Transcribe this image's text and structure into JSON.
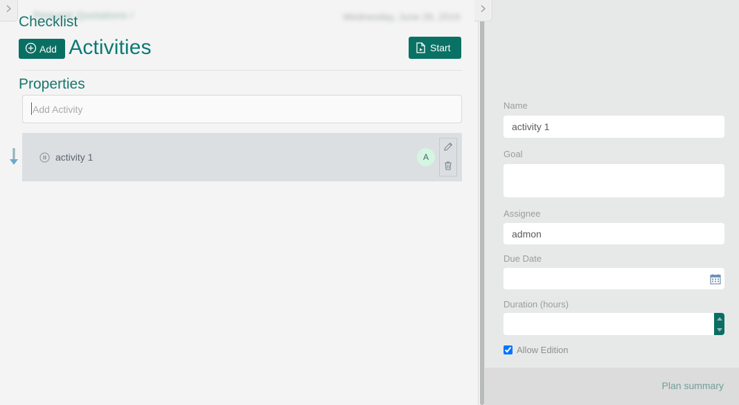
{
  "main": {
    "breadcrumb": "Request Quotations /",
    "date": "Wednesday, June 26, 2019",
    "title": "Plan Activities",
    "start_button": "Start",
    "add_activity_placeholder": "Add Activity",
    "add_activity_value": "",
    "activities": [
      {
        "name": "activity 1",
        "avatar_initial": "A",
        "status_icon": "pause-circle-icon"
      }
    ]
  },
  "panel": {
    "checklist_heading": "Checklist",
    "add_button": "Add",
    "properties_heading": "Properties",
    "fields": {
      "name_label": "Name",
      "name_value": "activity 1",
      "goal_label": "Goal",
      "goal_value": "",
      "assignee_label": "Assignee",
      "assignee_value": "admon",
      "duedate_label": "Due Date",
      "duedate_value": "",
      "duration_label": "Duration (hours)",
      "duration_value": ""
    },
    "allow_edition_label": "Allow Edition",
    "allow_edition_checked": true,
    "footer_link": "Plan summary"
  },
  "icons": {
    "collapse_left": "chevron-right-icon",
    "collapse_right": "chevron-right-icon",
    "start": "file-play-icon",
    "add": "plus-circle-icon",
    "edit": "pencil-icon",
    "delete": "trash-icon",
    "calendar": "calendar-icon",
    "spin_up": "caret-up-icon",
    "spin_down": "caret-down-icon",
    "drag": "arrow-down-cursor-icon"
  },
  "colors": {
    "accent_teal": "#0a7265",
    "heading_teal": "#0b7a72",
    "panel_bg": "#e7e9e9",
    "row_bg": "#dcdfe2",
    "avatar_bg": "#d4f5e2"
  }
}
